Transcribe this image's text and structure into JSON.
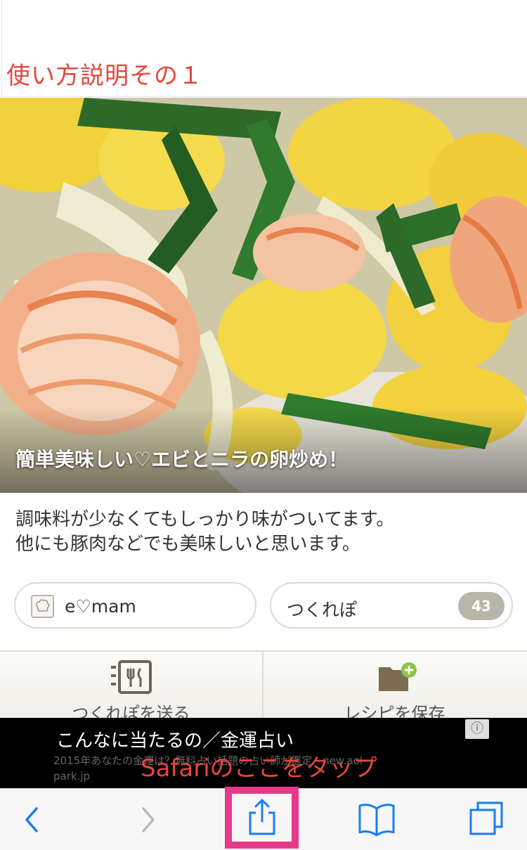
{
  "header": {
    "title": "使い方説明その１"
  },
  "recipe": {
    "title": "簡単美味しい♡エビとニラの卵炒め！",
    "description_lines": [
      "調味料が少なくてもしっかり味がついてます。",
      "他にも豚肉などでも美味しいと思います。"
    ],
    "author_name": "e♡mam",
    "tsukurepo_label": "つくれぽ",
    "tsukurepo_count": "43"
  },
  "actions": {
    "send_label": "つくれぽを送る",
    "save_label": "レシピを保存"
  },
  "ad": {
    "title": "こんなに当たるの／金運占い",
    "subtitle": "2015年あなたの金運は？無料占い話題の占い師が鑑定",
    "domain": "- new.aol-park.jp",
    "info_icon": "info-icon"
  },
  "annotation": {
    "text": "Safariのここをタップ",
    "color": "#e8388a"
  },
  "toolbar": {
    "icons": [
      "back-icon",
      "forward-icon",
      "share-icon",
      "bookmarks-icon",
      "tabs-icon"
    ],
    "accent": "#1a7cf2"
  },
  "colors": {
    "annotation_red": "#e8453c",
    "badge": "#b8b5a9"
  }
}
